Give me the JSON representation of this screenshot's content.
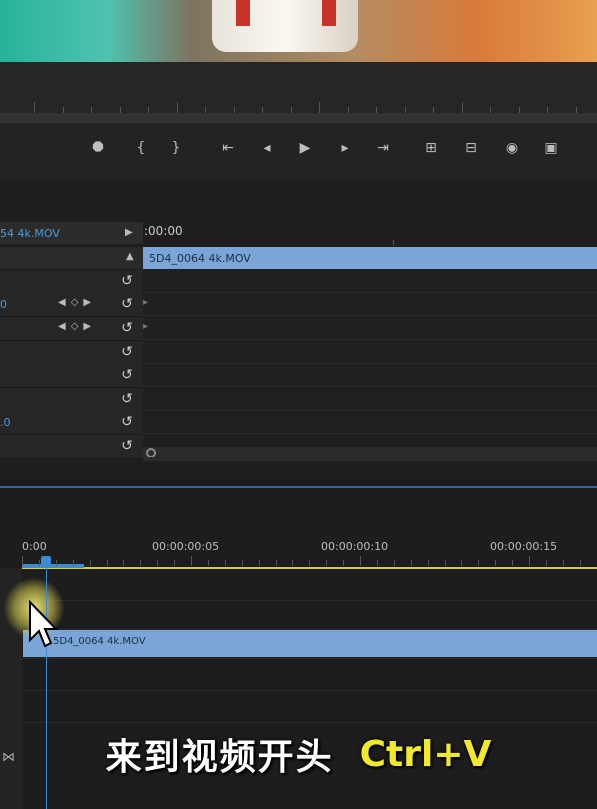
{
  "preview": {
    "description_colors": {
      "left": "#27b39a",
      "right": "#e8a050"
    }
  },
  "monitor": {
    "controls": [
      {
        "name": "marker-icon",
        "glyph": "⯃"
      },
      {
        "name": "mark-in-icon",
        "glyph": "{"
      },
      {
        "name": "mark-out-icon",
        "glyph": "}"
      },
      {
        "name": "go-to-in-icon",
        "glyph": "⇤"
      },
      {
        "name": "step-back-icon",
        "glyph": "◂"
      },
      {
        "name": "play-icon",
        "glyph": "▶"
      },
      {
        "name": "step-forward-icon",
        "glyph": "▸"
      },
      {
        "name": "go-to-out-icon",
        "glyph": "⇥"
      },
      {
        "name": "lift-icon",
        "glyph": "⊞"
      },
      {
        "name": "extract-icon",
        "glyph": "⊟"
      },
      {
        "name": "export-frame-icon",
        "glyph": "◉"
      },
      {
        "name": "compare-icon",
        "glyph": "▣"
      }
    ]
  },
  "effect_controls": {
    "clip_name": "54 4k.MOV",
    "timecode": ":00:00",
    "clip_label": "5D4_0064 4k.MOV",
    "row_values": [
      "",
      "0",
      "",
      "",
      "",
      "",
      ".0",
      ""
    ],
    "reset_glyph": "↺"
  },
  "timeline": {
    "timecodes": [
      "0:00",
      "00:00:00:05",
      "00:00:00:10",
      "00:00:00:15"
    ],
    "clip_label": "5D4_0064 4k.MOV"
  },
  "subtitle": {
    "text": "来到视频开头",
    "shortcut": "Ctrl+V"
  },
  "colors": {
    "accent_blue": "#3d8ad4",
    "clip_blue": "#7aa5d6",
    "shortcut_yellow": "#f1ea2c"
  }
}
